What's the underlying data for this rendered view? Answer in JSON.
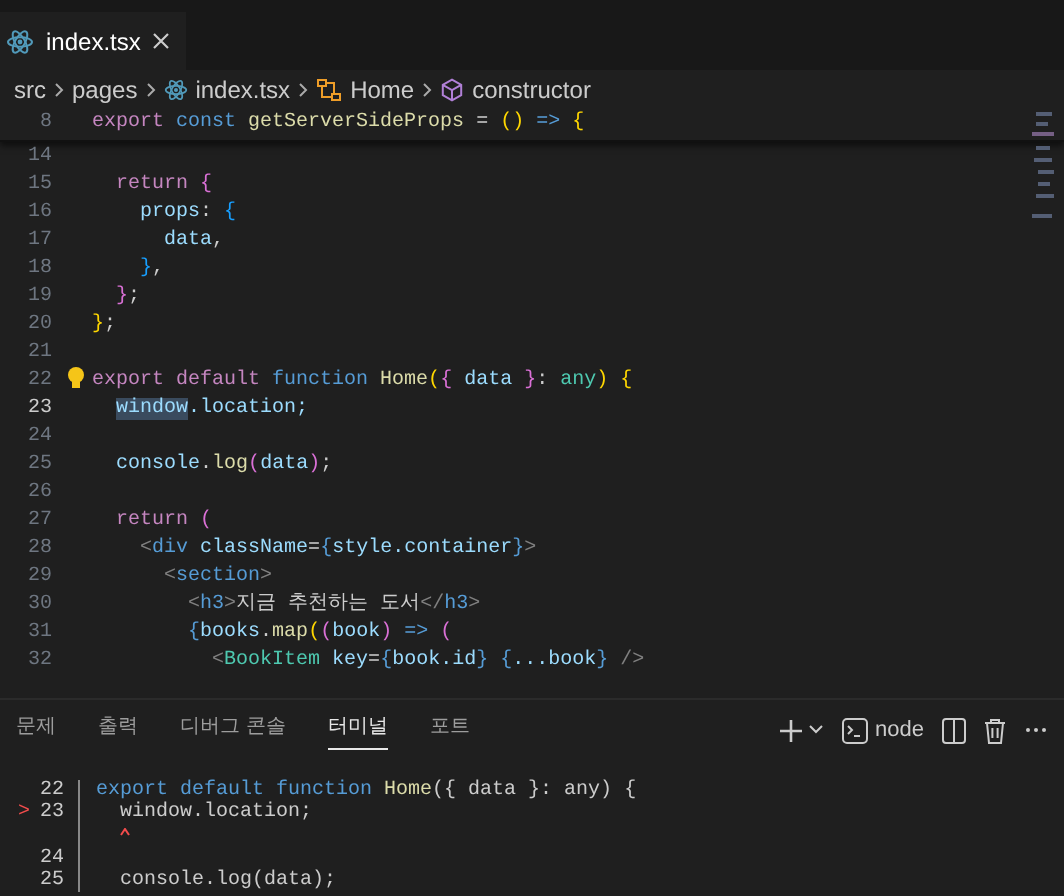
{
  "editor_tabs": [
    {
      "label": "index.tsx",
      "selected": true
    }
  ],
  "breadcrumb": [
    {
      "label": "src",
      "kind": "folder"
    },
    {
      "label": "pages",
      "kind": "folder"
    },
    {
      "label": "index.tsx",
      "kind": "react"
    },
    {
      "label": "Home",
      "kind": "function"
    },
    {
      "label": "constructor",
      "kind": "method"
    }
  ],
  "code": {
    "sticky_line": {
      "number": "8",
      "tokens": [
        {
          "text": "export",
          "kind": "keyword"
        },
        {
          "text": " const ",
          "kind": "storage"
        },
        {
          "text": "getServerSideProps",
          "kind": "function"
        },
        {
          "text": " = ",
          "kind": "plain"
        },
        {
          "text": "()",
          "kind": "bracket"
        },
        {
          "text": " => ",
          "kind": "storage"
        },
        {
          "text": "{",
          "kind": "bracket"
        }
      ]
    },
    "lines": [
      {
        "number": "14",
        "current": false
      },
      {
        "number": "15",
        "current": false,
        "tokens": [
          {
            "text": "  return",
            "kind": "keyword"
          },
          {
            "text": " {",
            "kind": "bracket2"
          }
        ]
      },
      {
        "number": "16",
        "current": false,
        "tokens": [
          {
            "text": "    props",
            "kind": "variable"
          },
          {
            "text": ": ",
            "kind": "plain"
          },
          {
            "text": "{",
            "kind": "bracket3"
          }
        ]
      },
      {
        "number": "17",
        "current": false,
        "tokens": [
          {
            "text": "      data",
            "kind": "variable"
          },
          {
            "text": ",",
            "kind": "plain"
          }
        ]
      },
      {
        "number": "18",
        "current": false,
        "tokens": [
          {
            "text": "    }",
            "kind": "bracket3"
          },
          {
            "text": ",",
            "kind": "plain"
          }
        ]
      },
      {
        "number": "19",
        "current": false,
        "tokens": [
          {
            "text": "  }",
            "kind": "bracket2"
          },
          {
            "text": ";",
            "kind": "plain"
          }
        ]
      },
      {
        "number": "20",
        "current": false,
        "tokens": [
          {
            "text": "}",
            "kind": "bracket"
          },
          {
            "text": ";",
            "kind": "plain"
          }
        ]
      },
      {
        "number": "21",
        "current": false
      },
      {
        "number": "22",
        "current": false,
        "lightbulb": true,
        "tokens": [
          {
            "text": "export default",
            "kind": "keyword"
          },
          {
            "text": " function ",
            "kind": "storage"
          },
          {
            "text": "Home",
            "kind": "function"
          },
          {
            "text": "(",
            "kind": "bracket"
          },
          {
            "text": "{ ",
            "kind": "bracket2"
          },
          {
            "text": "data",
            "kind": "variable"
          },
          {
            "text": " }",
            "kind": "bracket2"
          },
          {
            "text": ": ",
            "kind": "plain"
          },
          {
            "text": "any",
            "kind": "type"
          },
          {
            "text": ")",
            "kind": "bracket"
          },
          {
            "text": " {",
            "kind": "bracket"
          }
        ]
      },
      {
        "number": "23",
        "current": true,
        "tokens": [
          {
            "text": "  window",
            "kind": "variable",
            "highlight": true
          },
          {
            "text": ".location;",
            "kind": "variable"
          }
        ]
      },
      {
        "number": "24",
        "current": false
      },
      {
        "number": "25",
        "current": false,
        "tokens": [
          {
            "text": "  console",
            "kind": "variable"
          },
          {
            "text": ".",
            "kind": "plain"
          },
          {
            "text": "log",
            "kind": "function"
          },
          {
            "text": "(",
            "kind": "bracket2"
          },
          {
            "text": "data",
            "kind": "variable"
          },
          {
            "text": ")",
            "kind": "bracket2"
          },
          {
            "text": ";",
            "kind": "plain"
          }
        ]
      },
      {
        "number": "26",
        "current": false
      },
      {
        "number": "27",
        "current": false,
        "tokens": [
          {
            "text": "  return",
            "kind": "keyword"
          },
          {
            "text": " (",
            "kind": "bracket2"
          }
        ]
      },
      {
        "number": "28",
        "current": false,
        "tokens": [
          {
            "text": "    <",
            "kind": "tag"
          },
          {
            "text": "div",
            "kind": "storage"
          },
          {
            "text": " className",
            "kind": "variable"
          },
          {
            "text": "=",
            "kind": "plain"
          },
          {
            "text": "{",
            "kind": "storage"
          },
          {
            "text": "style.container",
            "kind": "variable"
          },
          {
            "text": "}",
            "kind": "storage"
          },
          {
            "text": ">",
            "kind": "tag"
          }
        ]
      },
      {
        "number": "29",
        "current": false,
        "tokens": [
          {
            "text": "      <",
            "kind": "tag"
          },
          {
            "text": "section",
            "kind": "storage"
          },
          {
            "text": ">",
            "kind": "tag"
          }
        ]
      },
      {
        "number": "30",
        "current": false,
        "tokens": [
          {
            "text": "        <",
            "kind": "tag"
          },
          {
            "text": "h3",
            "kind": "storage"
          },
          {
            "text": ">",
            "kind": "tag"
          },
          {
            "text": "지금 추천하는 도서",
            "kind": "plain"
          },
          {
            "text": "</",
            "kind": "tag"
          },
          {
            "text": "h3",
            "kind": "storage"
          },
          {
            "text": ">",
            "kind": "tag"
          }
        ]
      },
      {
        "number": "31",
        "current": false,
        "tokens": [
          {
            "text": "        {",
            "kind": "storage"
          },
          {
            "text": "books",
            "kind": "variable"
          },
          {
            "text": ".",
            "kind": "plain"
          },
          {
            "text": "map",
            "kind": "function"
          },
          {
            "text": "(",
            "kind": "bracket"
          },
          {
            "text": "(",
            "kind": "bracket2"
          },
          {
            "text": "book",
            "kind": "variable"
          },
          {
            "text": ")",
            "kind": "bracket2"
          },
          {
            "text": " => ",
            "kind": "storage"
          },
          {
            "text": "(",
            "kind": "bracket2"
          }
        ]
      },
      {
        "number": "32",
        "current": false,
        "tokens": [
          {
            "text": "          <",
            "kind": "tag"
          },
          {
            "text": "BookItem",
            "kind": "component"
          },
          {
            "text": " key",
            "kind": "variable"
          },
          {
            "text": "=",
            "kind": "plain"
          },
          {
            "text": "{",
            "kind": "storage"
          },
          {
            "text": "book.id",
            "kind": "variable"
          },
          {
            "text": "}",
            "kind": "storage"
          },
          {
            "text": " {",
            "kind": "storage"
          },
          {
            "text": "...book",
            "kind": "variable"
          },
          {
            "text": "}",
            "kind": "storage"
          },
          {
            "text": " />",
            "kind": "tag"
          }
        ]
      }
    ]
  },
  "panel_tabs": [
    {
      "label": "문제",
      "selected": false
    },
    {
      "label": "출력",
      "selected": false
    },
    {
      "label": "디버그 콘솔",
      "selected": false
    },
    {
      "label": "터미널",
      "selected": true
    },
    {
      "label": "포트",
      "selected": false
    }
  ],
  "terminal_profile": "node",
  "terminal": [
    {
      "number": "22",
      "tokens": [
        {
          "text": "export default function",
          "kind": "storage"
        },
        {
          "text": " Home",
          "kind": "function"
        },
        {
          "text": "({ data }: any) {",
          "kind": "plain"
        }
      ]
    },
    {
      "marker": ">",
      "number": "23",
      "tokens": [
        {
          "text": "  window.location;",
          "kind": "plain"
        }
      ]
    },
    {
      "caret": true
    },
    {
      "number": "24"
    },
    {
      "number": "25",
      "tokens": [
        {
          "text": "  console.log(data);",
          "kind": "plain"
        }
      ]
    }
  ]
}
